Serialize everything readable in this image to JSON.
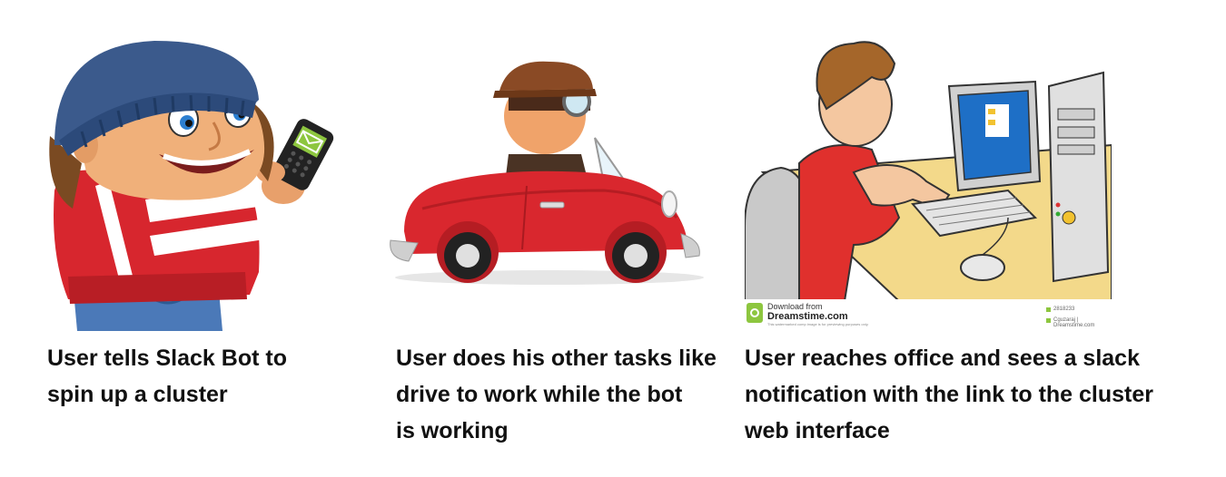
{
  "panels": [
    {
      "caption_lines": [
        "User tells Slack Bot to",
        "spin up a cluster"
      ]
    },
    {
      "caption_lines": [
        "User does his other tasks like",
        "drive to work while the bot",
        "is working"
      ]
    },
    {
      "caption_lines": [
        "User reaches office and sees a slack",
        "notification with the link to the cluster",
        "web interface"
      ],
      "watermark": {
        "line1": "Download from",
        "line2": "Dreamstime.com",
        "line3": "This watermarked comp image is for previewing purposes only.",
        "id": "2818233",
        "credit": "Cguzaraj | Dreamstime.com"
      }
    }
  ],
  "colors": {
    "caption_text": "#111111",
    "beanie": "#3b5a8c",
    "jacket_red": "#d7262e",
    "car_red": "#d9272e",
    "monitor_screen": "#1e6fc6",
    "shirt_red": "#e0302d",
    "desk_yellow": "#f3d98a",
    "phone_screen": "#8dc63f"
  }
}
